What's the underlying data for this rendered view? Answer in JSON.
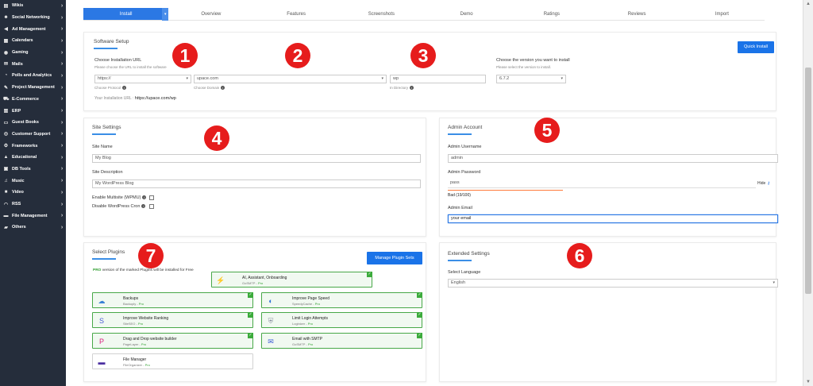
{
  "sidebar": {
    "items": [
      {
        "label": "Wikis",
        "icon": "book-icon"
      },
      {
        "label": "Social Networking",
        "icon": "users-icon"
      },
      {
        "label": "Ad Management",
        "icon": "bullhorn-icon"
      },
      {
        "label": "Calendars",
        "icon": "calendar-icon"
      },
      {
        "label": "Gaming",
        "icon": "gamepad-icon"
      },
      {
        "label": "Mails",
        "icon": "envelope-icon"
      },
      {
        "label": "Polls and Analytics",
        "icon": "chart-icon"
      },
      {
        "label": "Project Management",
        "icon": "edit-icon"
      },
      {
        "label": "E-Commerce",
        "icon": "cart-icon"
      },
      {
        "label": "ERP",
        "icon": "bar-chart-icon"
      },
      {
        "label": "Guest Books",
        "icon": "guestbook-icon"
      },
      {
        "label": "Customer Support",
        "icon": "support-icon"
      },
      {
        "label": "Frameworks",
        "icon": "cogs-icon"
      },
      {
        "label": "Educational",
        "icon": "graduation-cap-icon"
      },
      {
        "label": "DB Tools",
        "icon": "database-icon"
      },
      {
        "label": "Music",
        "icon": "music-icon"
      },
      {
        "label": "Video",
        "icon": "video-icon"
      },
      {
        "label": "RSS",
        "icon": "rss-icon"
      },
      {
        "label": "File Management",
        "icon": "folder-files-icon"
      },
      {
        "label": "Others",
        "icon": "folder-icon"
      }
    ],
    "arrow": "›"
  },
  "tabs": [
    "Install",
    "Overview",
    "Features",
    "Screenshots",
    "Demo",
    "Ratings",
    "Reviews",
    "Import"
  ],
  "software_setup": {
    "title": "Software Setup",
    "install_url_label": "Choose Installation URL",
    "install_url_hint": "Please choose the URL to install the software",
    "protocol_value": "https://",
    "protocol_hint": "Choose Protocol",
    "domain_value": "upace.com",
    "domain_hint": "Choose Domain",
    "directory_value": "wp",
    "directory_hint": "In Directory",
    "version_label": "Choose the version you want to install",
    "version_hint": "Please select the version to install.",
    "version_value": "6.7.2",
    "install_url_text": "Your Installation URL :",
    "install_url_value": "https://upace.com/wp",
    "quick_install": "Quick Install"
  },
  "site_settings": {
    "title": "Site Settings",
    "site_name_label": "Site Name",
    "site_name_value": "My Blog",
    "site_desc_label": "Site Description",
    "site_desc_value": "My WordPress Blog",
    "multisite_label": "Enable Multisite (WPMU)",
    "cron_label": "Disable WordPress Cron"
  },
  "admin_account": {
    "title": "Admin Account",
    "username_label": "Admin Username",
    "username_value": "admin",
    "password_label": "Admin Password",
    "password_value": "pass",
    "hide_label": "Hide",
    "strength_text": "Bad (19/100)",
    "email_label": "Admin Email",
    "email_value": "your email"
  },
  "plugins": {
    "title": "Select Plugins",
    "manage_button": "Manage Plugin Sets",
    "pro_prefix": "PRO",
    "pro_note": "version of the marked Plugins will be installed for Free",
    "items": [
      {
        "name": "AI, Assistant, Onboarding",
        "vendor": "GoSMTP",
        "tier": "Pro",
        "icon": "ai-assistant-icon",
        "color": "#3b5bd6"
      },
      {
        "name": "Backups",
        "vendor": "Backuply",
        "tier": "Pro",
        "icon": "cloud-backup-icon",
        "color": "#3b82d6"
      },
      {
        "name": "Improve Page Speed",
        "vendor": "SpeedyCache",
        "tier": "Pro",
        "icon": "speed-icon",
        "color": "#2a6fd6"
      },
      {
        "name": "Improve Website Ranking",
        "vendor": "SiteSEO",
        "tier": "Pro",
        "icon": "seo-icon",
        "color": "#4a5bd6"
      },
      {
        "name": "Limit Login Attempts",
        "vendor": "Loginizer",
        "tier": "Pro",
        "icon": "login-shield-icon",
        "color": "#8a8fa0"
      },
      {
        "name": "Drag and Drop website builder",
        "vendor": "PageLayer",
        "tier": "Pro",
        "icon": "pagelayer-icon",
        "color": "#d9207f"
      },
      {
        "name": "Email with SMTP",
        "vendor": "GoSMTP",
        "tier": "Pro",
        "icon": "email-smtp-icon",
        "color": "#3b5bd6"
      },
      {
        "name": "File Manager",
        "vendor": "FileOrganizer",
        "tier": "Pro",
        "icon": "file-manager-icon",
        "color": "#4b2fa0"
      }
    ]
  },
  "extended_settings": {
    "title": "Extended Settings",
    "language_label": "Select Language",
    "language_value": "English"
  },
  "markers": [
    "1",
    "2",
    "3",
    "4",
    "5",
    "6",
    "7"
  ]
}
